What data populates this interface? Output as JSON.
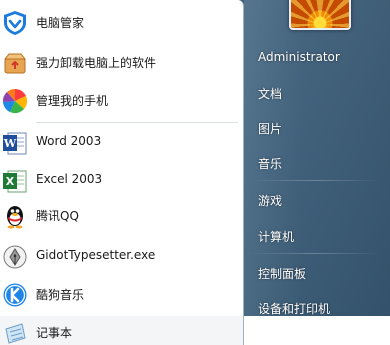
{
  "left_menu": {
    "items": [
      {
        "label": "电脑管家",
        "icon": "tencent-pc-manager-icon"
      },
      {
        "label": "强力卸载电脑上的软件",
        "icon": "uninstall-box-icon"
      },
      {
        "label": "管理我的手机",
        "icon": "phone-manager-icon"
      },
      {
        "label": "Word 2003",
        "icon": "word-icon"
      },
      {
        "label": "Excel 2003",
        "icon": "excel-icon"
      },
      {
        "label": "腾讯QQ",
        "icon": "qq-penguin-icon"
      },
      {
        "label": "GidotTypesetter.exe",
        "icon": "pen-nib-icon"
      },
      {
        "label": "酷狗音乐",
        "icon": "kugou-icon"
      },
      {
        "label": "记事本",
        "icon": "notepad-icon"
      }
    ]
  },
  "right_menu": {
    "items": [
      {
        "label": "Administrator"
      },
      {
        "label": "文档"
      },
      {
        "label": "图片"
      },
      {
        "label": "音乐"
      },
      {
        "label": "游戏"
      },
      {
        "label": "计算机"
      },
      {
        "label": "控制面板"
      },
      {
        "label": "设备和打印机"
      }
    ]
  },
  "colors": {
    "right_pane": "#3c5d79",
    "left_pane": "#ffffff"
  }
}
